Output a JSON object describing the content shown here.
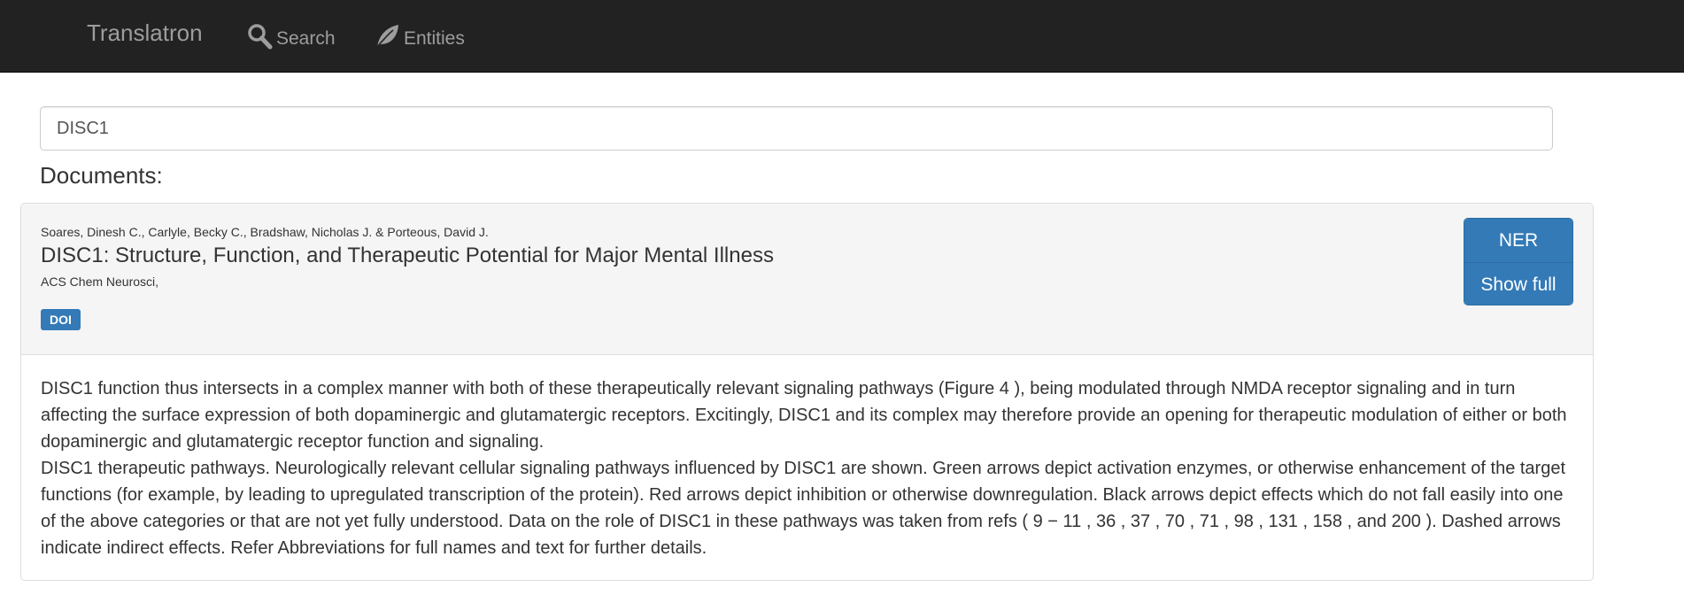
{
  "navbar": {
    "brand": "Translatron",
    "items": [
      {
        "label": "Search",
        "icon": "search-icon"
      },
      {
        "label": "Entities",
        "icon": "leaf-icon"
      }
    ]
  },
  "search": {
    "value": "DISC1"
  },
  "documents": {
    "heading": "Documents:",
    "items": [
      {
        "authors": "Soares, Dinesh C., Carlyle, Becky C., Bradshaw, Nicholas J. & Porteous, David J.",
        "title": "DISC1: Structure, Function, and Therapeutic Potential for Major Mental Illness",
        "journal": "ACS Chem Neurosci,",
        "badge": "DOI",
        "buttons": {
          "ner": "NER",
          "show_full": "Show full"
        },
        "paragraphs": [
          "DISC1 function thus intersects in a complex manner with both of these therapeutically relevant signaling pathways (Figure 4 ), being modulated through NMDA receptor signaling and in turn affecting the surface expression of both dopaminergic and glutamatergic receptors. Excitingly, DISC1 and its complex may therefore provide an opening for therapeutic modulation of either or both dopaminergic and glutamatergic receptor function and signaling.",
          "DISC1 therapeutic pathways. Neurologically relevant cellular signaling pathways influenced by DISC1 are shown. Green arrows depict activation enzymes, or otherwise enhancement of the target functions (for example, by leading to upregulated transcription of the protein). Red arrows depict inhibition or otherwise downregulation. Black arrows depict effects which do not fall easily into one of the above categories or that are not yet fully understood. Data on the role of DISC1 in these pathways was taken from refs ( 9 − 11 , 36 , 37 , 70 , 71 , 98 , 131 , 158 , and 200 ). Dashed arrows indicate indirect effects. Refer Abbreviations for full names and text for further details."
        ]
      }
    ]
  },
  "colors": {
    "navbar_bg": "#222222",
    "nav_text": "#9d9d9d",
    "primary": "#337ab7",
    "panel_heading_bg": "#f5f5f5"
  }
}
